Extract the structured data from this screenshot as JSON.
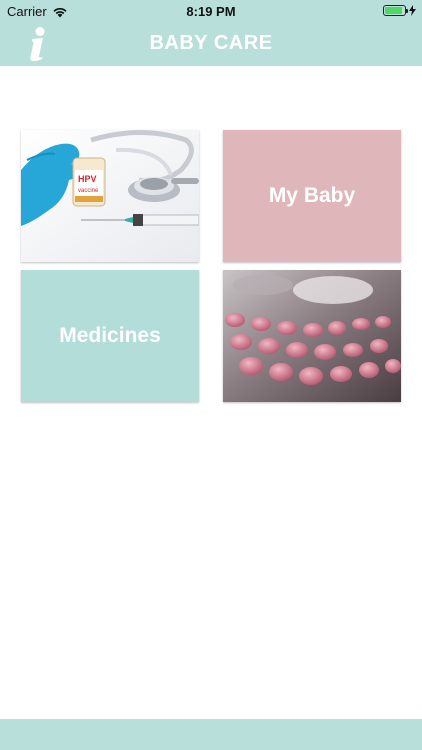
{
  "status_bar": {
    "carrier": "Carrier",
    "time": "8:19 PM",
    "battery_level_percent": 90
  },
  "header": {
    "title": "BABY CARE",
    "info_icon": "info-icon"
  },
  "tiles": [
    {
      "label": "",
      "image": "vaccine-stethoscope-photo",
      "photo_text": "HPV vaccine"
    },
    {
      "label": "My Baby"
    },
    {
      "label": "Medicines"
    },
    {
      "label": "",
      "image": "pills-blister-photo"
    }
  ],
  "colors": {
    "header_bg": "#b9dfdb",
    "my_baby_tile": "#dfb6b9",
    "medicines_tile": "#b3ddd8",
    "title_text": "#ffffff"
  }
}
